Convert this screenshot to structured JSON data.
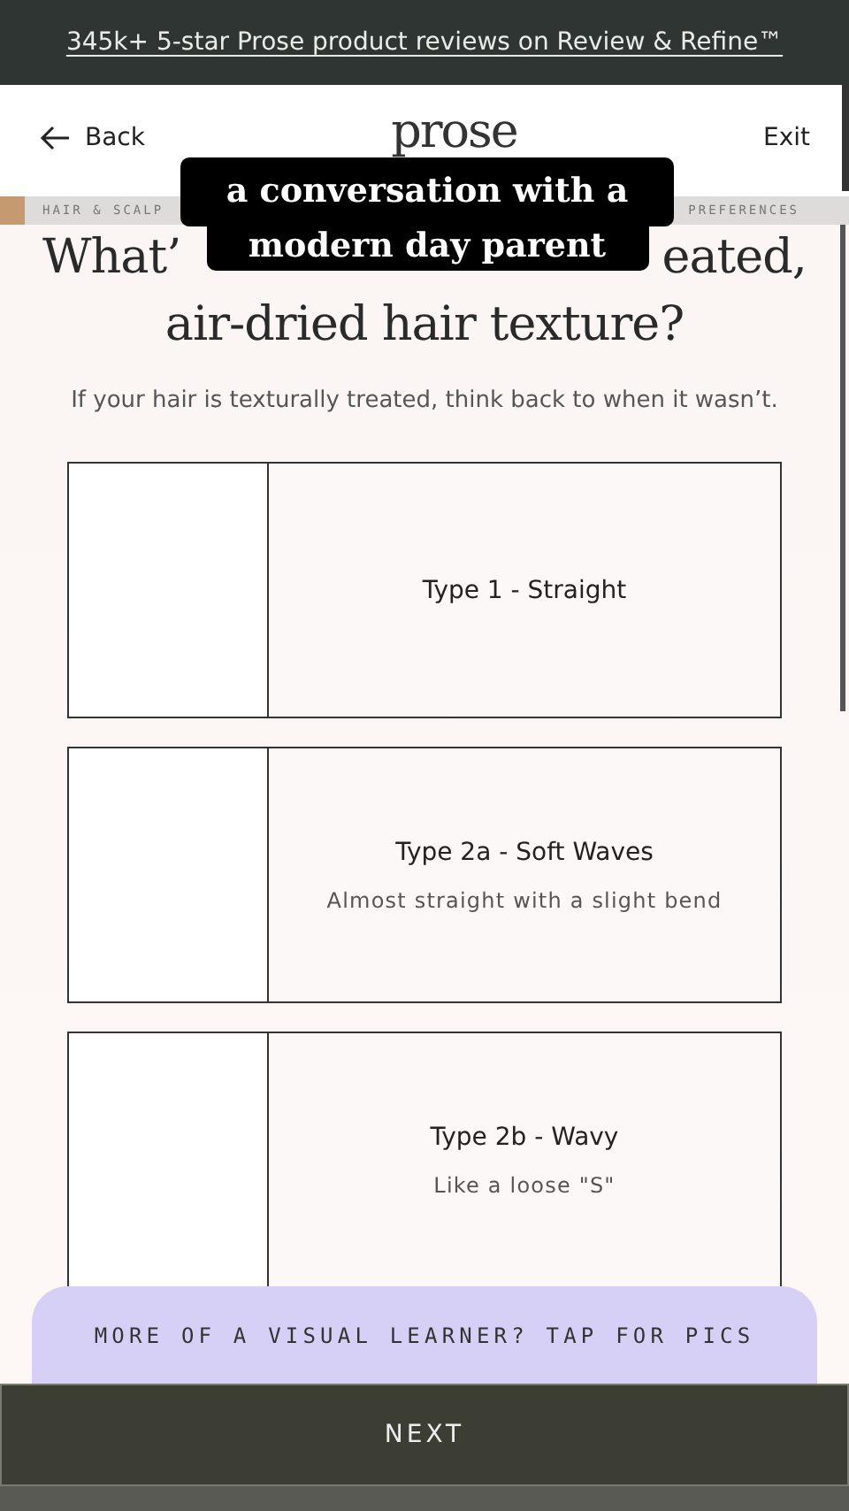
{
  "banner": {
    "link": "345k+ 5-star Prose product reviews on Review & Refine™"
  },
  "header": {
    "back": "Back",
    "logo": "prose",
    "exit": "Exit"
  },
  "progress": {
    "level": 0.03,
    "steps": [
      "HAIR & SCALP",
      "PREFERENCES"
    ]
  },
  "question": {
    "line_1_start": "What’",
    "line_1_end": "eated,",
    "line_2": "air-dried hair texture?",
    "hint": "If your hair is texturally treated, think back to when it wasn’t."
  },
  "options": [
    {
      "title": "Type 1 - Straight"
    },
    {
      "title": "Type 2a - Soft Waves",
      "description": "Almost straight with a slight bend"
    },
    {
      "title": "Type 2b - Wavy",
      "description": "Like a loose \"S\""
    }
  ],
  "visual_button": "MORE OF A VISUAL LEARNER? TAP FOR PICS",
  "next_button": "NEXT",
  "caption": {
    "lines": [
      "a conversation with a",
      "modern day parent"
    ]
  }
}
